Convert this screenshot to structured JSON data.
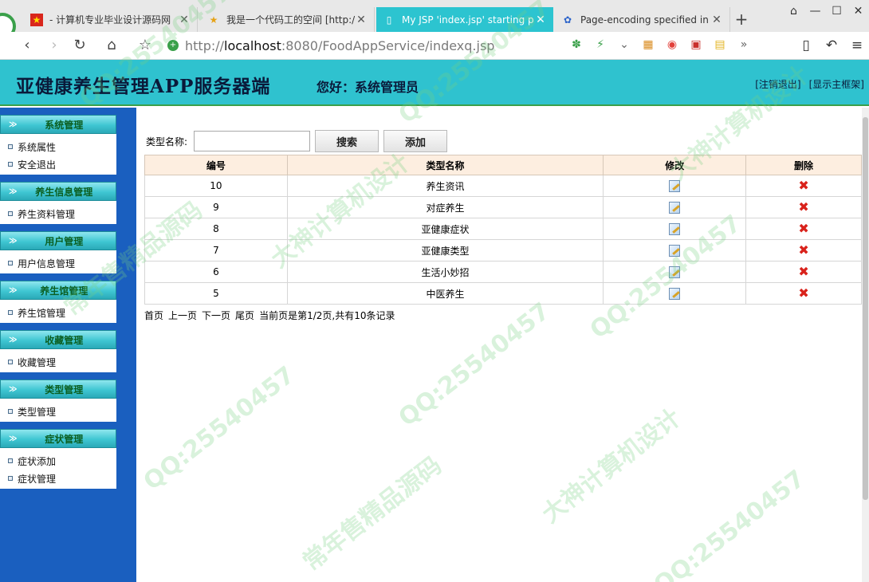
{
  "browser": {
    "tabs": [
      {
        "title": "- 计算机专业毕业设计源码网",
        "icon": "flag-icon"
      },
      {
        "title": "我是一个代码工的空间 [http:/",
        "icon": "star-icon"
      },
      {
        "title": "My JSP 'index.jsp' starting p",
        "icon": "page-icon",
        "active": true
      },
      {
        "title": "Page-encoding specified in",
        "icon": "paw-icon"
      }
    ],
    "new_tab": "+",
    "url_host": "localhost",
    "url_prefix": "http://",
    "url_rest": ":8080/FoodAppService/indexq.jsp"
  },
  "header": {
    "title": "亚健康养生管理APP服务器端",
    "greeting": "您好：系统管理员",
    "logout": "[注销退出]",
    "show_main": "[显示主框架]"
  },
  "sidebar": {
    "groups": [
      {
        "label": "系统管理",
        "items": [
          "系统属性",
          "安全退出"
        ]
      },
      {
        "label": "养生信息管理",
        "items": [
          "养生资料管理"
        ]
      },
      {
        "label": "用户管理",
        "items": [
          "用户信息管理"
        ]
      },
      {
        "label": "养生馆管理",
        "items": [
          "养生馆管理"
        ]
      },
      {
        "label": "收藏管理",
        "items": [
          "收藏管理"
        ]
      },
      {
        "label": "类型管理",
        "items": [
          "类型管理"
        ]
      },
      {
        "label": "症状管理",
        "items": [
          "症状添加",
          "症状管理"
        ]
      }
    ]
  },
  "search": {
    "label": "类型名称:",
    "value": "",
    "search_button": "搜索",
    "add_button": "添加"
  },
  "table": {
    "headers": [
      "编号",
      "类型名称",
      "修改",
      "删除"
    ],
    "rows": [
      {
        "id": "10",
        "name": "养生资讯"
      },
      {
        "id": "9",
        "name": "对症养生"
      },
      {
        "id": "8",
        "name": "亚健康症状"
      },
      {
        "id": "7",
        "name": "亚健康类型"
      },
      {
        "id": "6",
        "name": "生活小妙招"
      },
      {
        "id": "5",
        "name": "中医养生"
      }
    ]
  },
  "pager": {
    "first": "首页",
    "prev": "上一页",
    "next": "下一页",
    "last": "尾页",
    "status": "当前页是第1/2页,共有10条记录"
  },
  "watermark": {
    "qq": "QQ:25540457",
    "a": "大神计算机设计",
    "b": "常年售精品源码"
  }
}
